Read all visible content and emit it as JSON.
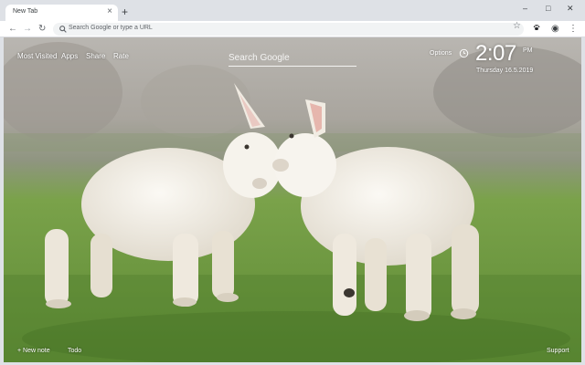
{
  "browser": {
    "tab_title": "New Tab",
    "tab_close": "×",
    "new_tab": "+",
    "window_controls": {
      "minimize": "–",
      "maximize": "□",
      "close": "✕"
    },
    "omnibox_placeholder": "Search Google or type a URL",
    "icons": [
      "back-arrow-icon",
      "forward-arrow-icon",
      "reload-icon",
      "search-icon",
      "star-icon",
      "paw-extension-icon",
      "profile-icon",
      "menu-dots-icon"
    ]
  },
  "page": {
    "top_links": [
      "Most Visited",
      "Apps",
      "Share",
      "Rate"
    ],
    "search_placeholder": "Search Google",
    "options_label": "Options",
    "clock": {
      "time": "2:07",
      "ampm": "PM",
      "date": "Thursday   16.5.2019"
    },
    "bottom_left": {
      "new_note": "+ New note",
      "todo": "Todo"
    },
    "bottom_right": {
      "support": "Support"
    },
    "background": "two white lambs touching heads on a green meadow"
  },
  "colors": {
    "chrome_bg": "#dee1e6",
    "toolbar_bg": "#ffffff",
    "omnibox_bg": "#f1f3f4",
    "text_white": "#ffffff",
    "grass": "#6a9a3c",
    "lamb": "#f1ece3"
  }
}
